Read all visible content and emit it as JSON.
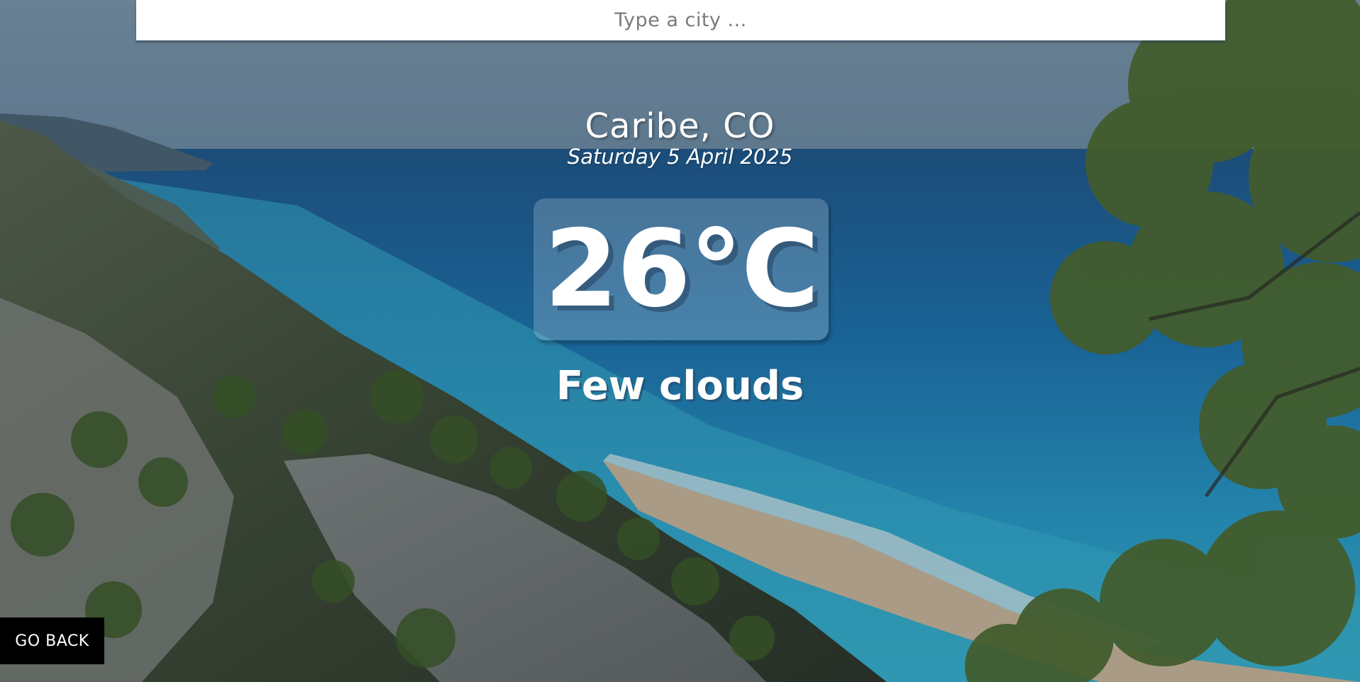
{
  "search": {
    "placeholder": "Type a city ..."
  },
  "weather": {
    "location": "Caribe, CO",
    "date": "Saturday 5 April 2025",
    "temperature": "26°C",
    "condition": "Few clouds"
  },
  "actions": {
    "go_back_label": "GO BACK"
  },
  "colors": {
    "search_bg": "#ffffff",
    "button_bg": "#000000",
    "text": "#ffffff"
  }
}
